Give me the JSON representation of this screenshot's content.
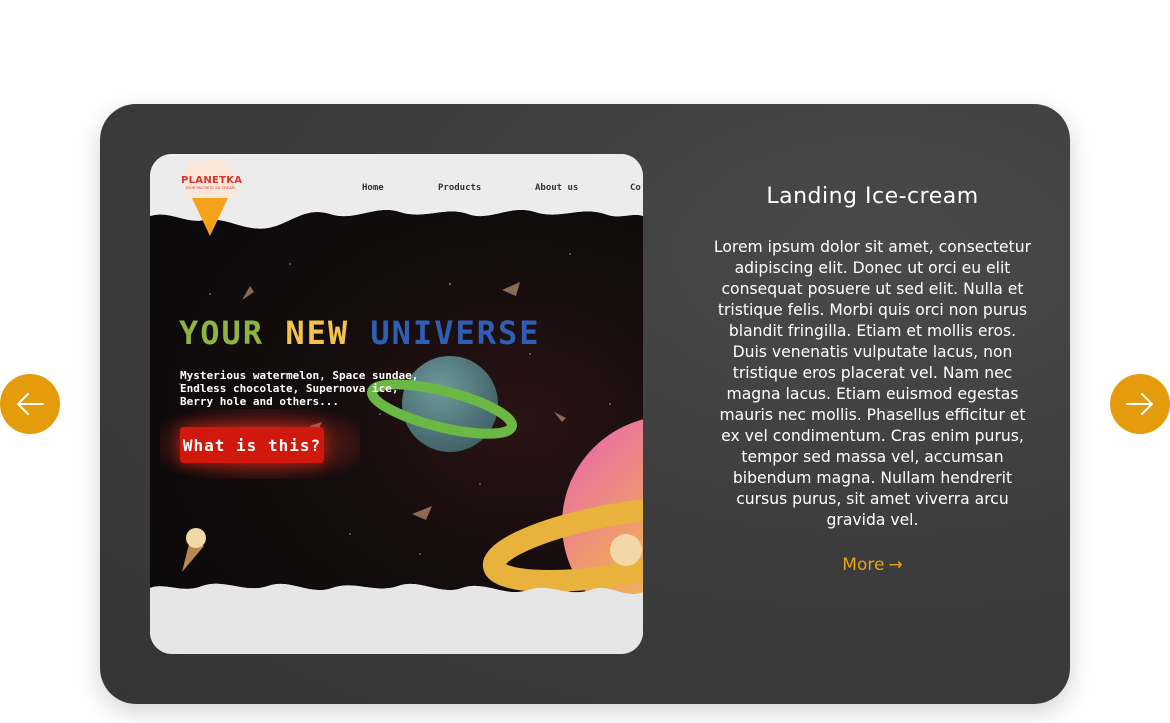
{
  "card": {
    "title": "Landing Ice-cream",
    "description": "Lorem ipsum dolor sit amet, consectetur adipiscing elit. Donec ut orci eu elit consequat posuere ut sed elit. Nulla et tristique felis. Morbi quis orci non purus blandit fringilla. Etiam et mollis eros. Duis venenatis vulputate lacus, non tristique eros placerat vel. Nam nec magna lacus. Etiam euismod egestas mauris nec mollis. Phasellus efficitur et ex vel condimentum. Cras enim purus, tempor sed massa vel, accumsan bibendum magna. Nullam hendrerit cursus purus, sit amet viverra arcu gravida vel.",
    "more_label": "More",
    "more_arrow": "→"
  },
  "preview": {
    "logo_text": "PLANETKA",
    "logo_tagline": "YOUR FAVORITE ICE CREAM",
    "nav": [
      "Home",
      "Products",
      "About us",
      "Co"
    ],
    "headline_words": [
      "YOUR",
      "NEW",
      "UNIVERSE"
    ],
    "sub_lines": [
      "Mysterious watermelon, Space sundae,",
      "Endless chocolate, Supernova ice,",
      "Berry hole and others..."
    ],
    "cta_label": "What is this?"
  },
  "navigation": {
    "prev_icon": "arrow-left-icon",
    "next_icon": "arrow-right-icon"
  },
  "colors": {
    "accent": "#e59c0c",
    "card_bg": "#3d3d3d",
    "cta": "#d0180c",
    "headline_green": "#8fb340",
    "headline_yellow": "#f2c14e",
    "headline_blue": "#2f5fb5"
  }
}
